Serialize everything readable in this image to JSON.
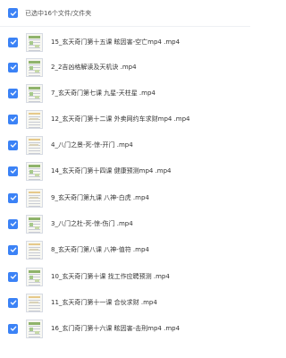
{
  "header": {
    "selected_text": "已选中16个文件/文件夹"
  },
  "colors": {
    "accent": "#3b82f6"
  },
  "files": [
    {
      "name": "15_玄天奇门第十五课 眩因害-空亡mp4 .mp4",
      "checked": true,
      "thumb": "green"
    },
    {
      "name": "2_2吉凶格解读及天机诀 .mp4",
      "checked": true,
      "thumb": "green"
    },
    {
      "name": "7_玄天奇门第七课 九星-天柱星 .mp4",
      "checked": true,
      "thumb": "green"
    },
    {
      "name": "12_玄天奇门第十二课 外卖网约车求财mp4 .mp4",
      "checked": true,
      "thumb": "plain"
    },
    {
      "name": "4_八门之景-死-惊-开门 .mp4",
      "checked": true,
      "thumb": "plain"
    },
    {
      "name": "14_玄天奇门第十四课 健康预测mp4 .mp4",
      "checked": true,
      "thumb": "green"
    },
    {
      "name": "9_玄天奇门第九课 八神-白虎 .mp4",
      "checked": true,
      "thumb": "plain"
    },
    {
      "name": "3_八门之杜-死-惊-伤门 .mp4",
      "checked": true,
      "thumb": "green"
    },
    {
      "name": "8_玄天奇门第八课 八神-值符 .mp4",
      "checked": true,
      "thumb": "plain"
    },
    {
      "name": "10_玄天奇门第十课 找工作应聘预测 .mp4",
      "checked": true,
      "thumb": "green"
    },
    {
      "name": "11_玄天奇门第十一课 合伙求财 .mp4",
      "checked": true,
      "thumb": "plain"
    },
    {
      "name": "16_玄门奇门第十六课 眩因害-击刑mp4 .mp4",
      "checked": true,
      "thumb": "green"
    }
  ]
}
